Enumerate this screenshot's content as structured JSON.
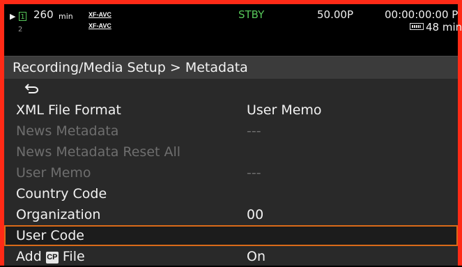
{
  "status": {
    "play_indicator": "▶",
    "slot1_label": "1",
    "slot1_remaining": "260",
    "slot1_unit": "min",
    "slot2_label": "2",
    "codec_top": "XF-AVC",
    "codec_bottom": "XF-AVC",
    "mode": "STBY",
    "frame_rate": "50.00P",
    "timecode": "00:00:00:00 P",
    "battery_remaining": "48 min",
    "mode_color": "#57c85a"
  },
  "menu": {
    "title": "Recording/Media Setup > Metadata",
    "back_icon": "back-arrow-icon",
    "items": [
      {
        "label": "XML File Format",
        "value": "User Memo",
        "state": "enabled"
      },
      {
        "label": "News Metadata",
        "value": "---",
        "state": "disabled"
      },
      {
        "label": "News Metadata Reset All",
        "value": "",
        "state": "disabled"
      },
      {
        "label": "User Memo",
        "value": "---",
        "state": "disabled"
      },
      {
        "label": "Country Code",
        "value": "",
        "state": "enabled"
      },
      {
        "label": "Organization",
        "value": "00",
        "state": "enabled"
      },
      {
        "label": "User Code",
        "value": "",
        "state": "selected"
      },
      {
        "label_prefix": "Add",
        "label_icon": "CP",
        "label_suffix": "File",
        "value": "On",
        "state": "enabled"
      }
    ]
  },
  "colors": {
    "frame": "#ff2a16",
    "selection": "#d96a19"
  }
}
